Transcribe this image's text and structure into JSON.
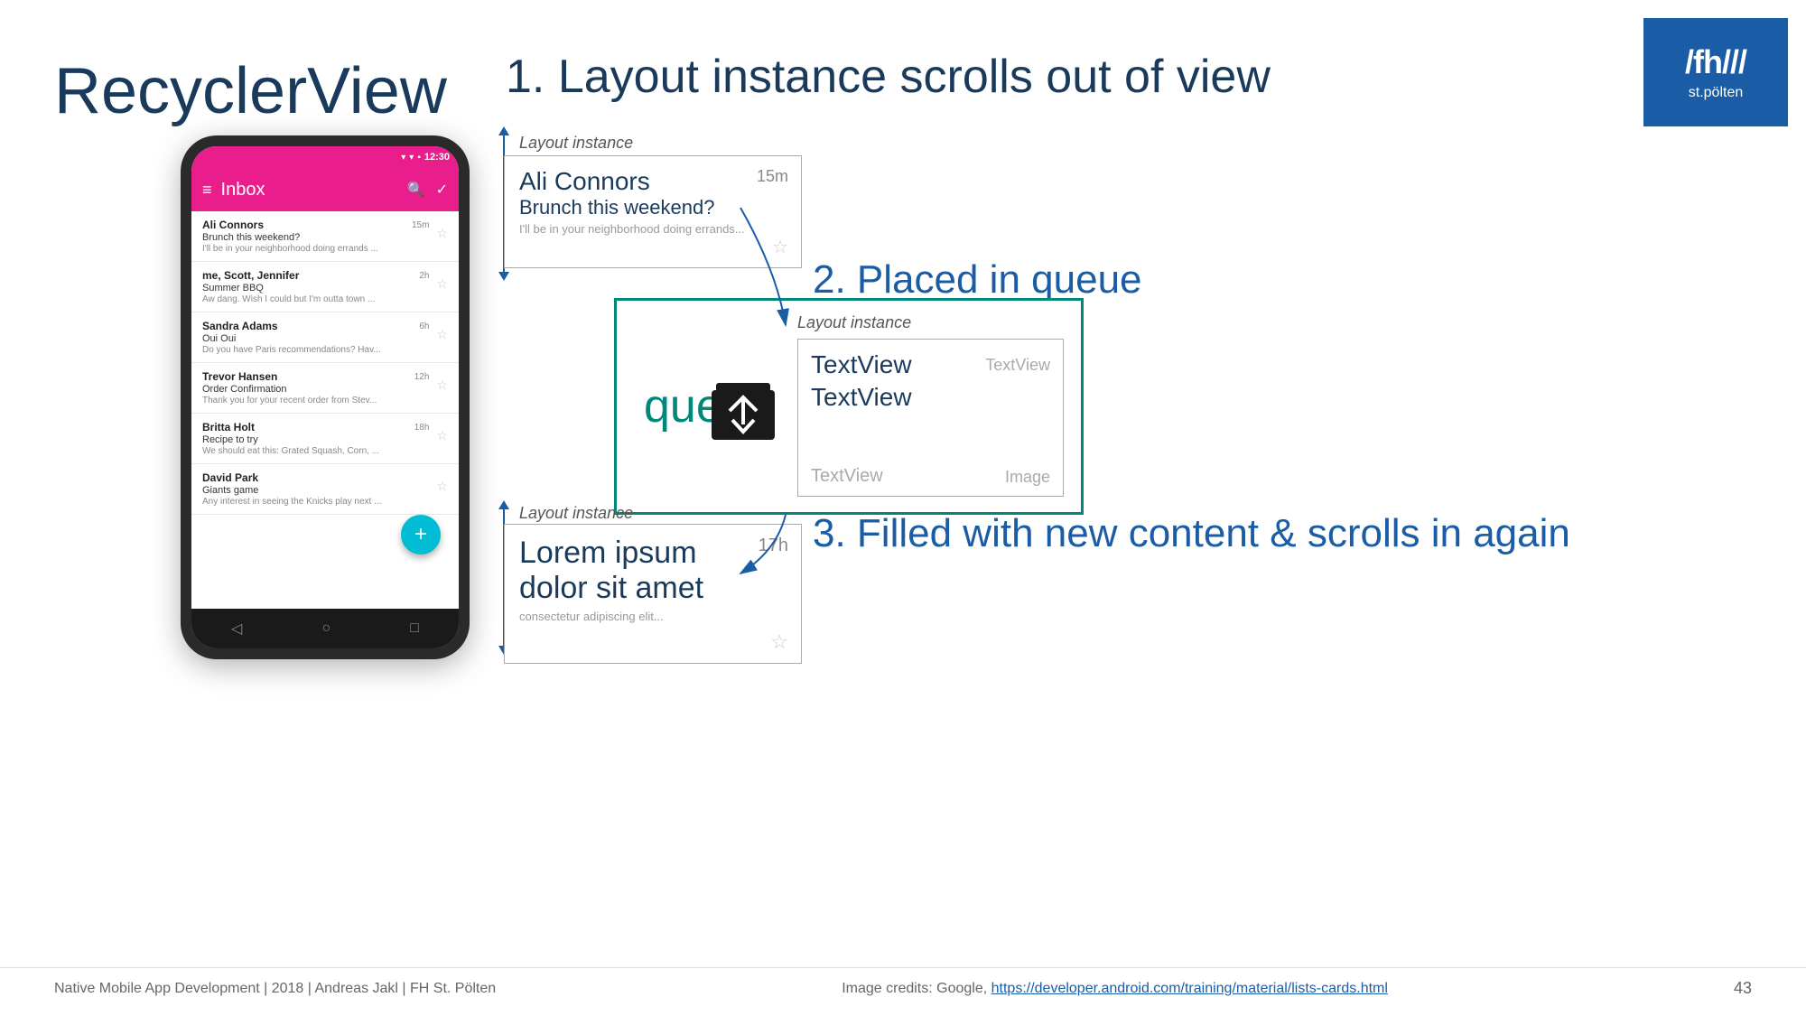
{
  "page": {
    "title": "RecyclerView",
    "slide_number": "43"
  },
  "header": {
    "section1": "1. Layout instance scrolls out of view",
    "section2": "2. Placed in queue",
    "section3": "3. Filled with new content & scrolls in again"
  },
  "logo": {
    "line1": "/fh///",
    "line2": "st.pölten"
  },
  "phone": {
    "status_time": "12:30",
    "toolbar_title": "Inbox",
    "emails": [
      {
        "sender": "Ali Connors",
        "subject": "Brunch this weekend?",
        "preview": "I'll be in your neighborhood doing errands ...",
        "time": "15m"
      },
      {
        "sender": "me, Scott, Jennifer",
        "subject": "Summer BBQ",
        "preview": "Aw dang. Wish I could but I'm outta town ...",
        "time": "2h"
      },
      {
        "sender": "Sandra Adams",
        "subject": "Oui Oui",
        "preview": "Do you have Paris recommendations? Hav...",
        "time": "6h"
      },
      {
        "sender": "Trevor Hansen",
        "subject": "Order Confirmation",
        "preview": "Thank you for your recent order from Stev...",
        "time": "12h"
      },
      {
        "sender": "Britta Holt",
        "subject": "Recipe to try",
        "preview": "We should eat this: Grated Squash, Corn, ...",
        "time": "18h"
      },
      {
        "sender": "David Park",
        "subject": "Giants game",
        "preview": "Any interest in seeing the Knicks play next ...",
        "time": ""
      }
    ]
  },
  "layout_instance_1": {
    "label": "Layout instance",
    "sender": "Ali Connors",
    "subject": "Brunch this weekend?",
    "preview": "I'll be in your neighborhood doing errands...",
    "time": "15m"
  },
  "queue": {
    "label": "queue",
    "layout_instance_label": "Layout instance",
    "textview1": "TextView",
    "textview2": "TextView",
    "textview3": "TextView",
    "textview4": "TextView",
    "image_label": "Image"
  },
  "layout_instance_3": {
    "label": "Layout instance",
    "name": "Lorem ipsum",
    "subject": "dolor sit amet",
    "preview": "consectetur adipiscing elit...",
    "time": "17h"
  },
  "footer": {
    "left": "Native Mobile App Development | 2018 | Andreas Jakl | FH St. Pölten",
    "center_text": "Image credits: Google, ",
    "center_link": "https://developer.android.com/training/material/lists-cards.html",
    "page_number": "43"
  }
}
